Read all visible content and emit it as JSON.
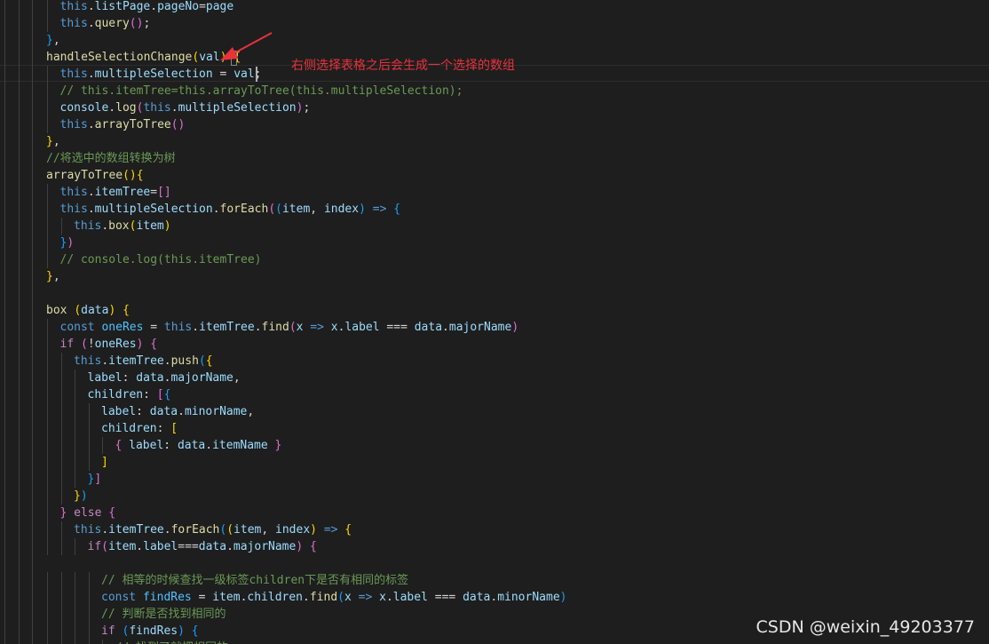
{
  "annotation": {
    "text": "右侧选择表格之后会生成一个选择的数组",
    "color": "#e8323c"
  },
  "watermark": "CSDN @weixin_49203377",
  "theme": {
    "background": "#1e1e1e",
    "keyword": "#569cd6",
    "control": "#c586c0",
    "function": "#dcdcaa",
    "variable": "#9cdcfe",
    "comment": "#6a9955"
  },
  "lines": [
    {
      "indent": 1,
      "tokens": [
        [
          "kw",
          "this"
        ],
        [
          "p",
          "."
        ],
        [
          "var",
          "listPage"
        ],
        [
          "p",
          "."
        ],
        [
          "var",
          "pageNo"
        ],
        [
          "p",
          "="
        ],
        [
          "var",
          "page"
        ]
      ]
    },
    {
      "indent": 1,
      "tokens": [
        [
          "kw",
          "this"
        ],
        [
          "p",
          "."
        ],
        [
          "fn",
          "query"
        ],
        [
          "br2",
          "()"
        ],
        [
          "p",
          ";"
        ]
      ]
    },
    {
      "indent": 0,
      "tokens": [
        [
          "br3",
          "}"
        ],
        [
          "p",
          ","
        ]
      ]
    },
    {
      "indent": 0,
      "tokens": [
        [
          "fn",
          "handleSelectionChange"
        ],
        [
          "br1",
          "("
        ],
        [
          "var",
          "val"
        ],
        [
          "br1",
          ")"
        ],
        [
          "p",
          " "
        ],
        [
          "br1",
          "{"
        ]
      ]
    },
    {
      "indent": 1,
      "tokens": [
        [
          "kw",
          "this"
        ],
        [
          "p",
          "."
        ],
        [
          "var",
          "multipleSelection"
        ],
        [
          "p",
          " = "
        ],
        [
          "var",
          "val"
        ],
        [
          "p",
          ";"
        ]
      ]
    },
    {
      "indent": 1,
      "tokens": [
        [
          "cm",
          "// this.itemTree=this.arrayToTree(this.multipleSelection);"
        ]
      ]
    },
    {
      "indent": 1,
      "tokens": [
        [
          "var",
          "console"
        ],
        [
          "p",
          "."
        ],
        [
          "fn",
          "log"
        ],
        [
          "br2",
          "("
        ],
        [
          "kw",
          "this"
        ],
        [
          "p",
          "."
        ],
        [
          "var",
          "multipleSelection"
        ],
        [
          "br2",
          ")"
        ],
        [
          "p",
          ";"
        ]
      ]
    },
    {
      "indent": 1,
      "tokens": [
        [
          "kw",
          "this"
        ],
        [
          "p",
          "."
        ],
        [
          "fn",
          "arrayToTree"
        ],
        [
          "br2",
          "()"
        ]
      ]
    },
    {
      "indent": 0,
      "tokens": [
        [
          "br1",
          "}"
        ],
        [
          "p",
          ","
        ]
      ]
    },
    {
      "indent": 0,
      "tokens": [
        [
          "cm",
          "//将选中的数组转换为树"
        ]
      ]
    },
    {
      "indent": 0,
      "tokens": [
        [
          "fn",
          "arrayToTree"
        ],
        [
          "br1",
          "()"
        ],
        [
          "br1",
          "{"
        ]
      ]
    },
    {
      "indent": 1,
      "tokens": [
        [
          "kw",
          "this"
        ],
        [
          "p",
          "."
        ],
        [
          "var",
          "itemTree"
        ],
        [
          "p",
          "="
        ],
        [
          "br2",
          "[]"
        ]
      ]
    },
    {
      "indent": 1,
      "tokens": [
        [
          "kw",
          "this"
        ],
        [
          "p",
          "."
        ],
        [
          "var",
          "multipleSelection"
        ],
        [
          "p",
          "."
        ],
        [
          "fn",
          "forEach"
        ],
        [
          "br2",
          "("
        ],
        [
          "br3",
          "("
        ],
        [
          "var",
          "item"
        ],
        [
          "p",
          ", "
        ],
        [
          "var",
          "index"
        ],
        [
          "br3",
          ")"
        ],
        [
          "p",
          " "
        ],
        [
          "kw",
          "=>"
        ],
        [
          "p",
          " "
        ],
        [
          "br3",
          "{"
        ]
      ]
    },
    {
      "indent": 2,
      "tokens": [
        [
          "kw",
          "this"
        ],
        [
          "p",
          "."
        ],
        [
          "fn",
          "box"
        ],
        [
          "br1",
          "("
        ],
        [
          "var",
          "item"
        ],
        [
          "br1",
          ")"
        ]
      ]
    },
    {
      "indent": 1,
      "tokens": [
        [
          "br3",
          "}"
        ],
        [
          "br2",
          ")"
        ]
      ]
    },
    {
      "indent": 1,
      "tokens": [
        [
          "cm",
          "// console.log(this.itemTree)"
        ]
      ]
    },
    {
      "indent": 0,
      "tokens": [
        [
          "br1",
          "}"
        ],
        [
          "p",
          ","
        ]
      ]
    },
    {
      "indent": 0,
      "tokens": []
    },
    {
      "indent": 0,
      "tokens": [
        [
          "fn",
          "box"
        ],
        [
          "p",
          " "
        ],
        [
          "br1",
          "("
        ],
        [
          "var",
          "data"
        ],
        [
          "br1",
          ")"
        ],
        [
          "p",
          " "
        ],
        [
          "br1",
          "{"
        ]
      ]
    },
    {
      "indent": 1,
      "tokens": [
        [
          "kw",
          "const"
        ],
        [
          "p",
          " "
        ],
        [
          "cst",
          "oneRes"
        ],
        [
          "p",
          " = "
        ],
        [
          "kw",
          "this"
        ],
        [
          "p",
          "."
        ],
        [
          "var",
          "itemTree"
        ],
        [
          "p",
          "."
        ],
        [
          "fn",
          "find"
        ],
        [
          "br2",
          "("
        ],
        [
          "var",
          "x"
        ],
        [
          "p",
          " "
        ],
        [
          "kw",
          "=>"
        ],
        [
          "p",
          " "
        ],
        [
          "var",
          "x"
        ],
        [
          "p",
          "."
        ],
        [
          "var",
          "label"
        ],
        [
          "p",
          " === "
        ],
        [
          "var",
          "data"
        ],
        [
          "p",
          "."
        ],
        [
          "var",
          "majorName"
        ],
        [
          "br2",
          ")"
        ]
      ]
    },
    {
      "indent": 1,
      "tokens": [
        [
          "ctrl",
          "if"
        ],
        [
          "p",
          " "
        ],
        [
          "br2",
          "("
        ],
        [
          "p",
          "!"
        ],
        [
          "var",
          "oneRes"
        ],
        [
          "br2",
          ")"
        ],
        [
          "p",
          " "
        ],
        [
          "br2",
          "{"
        ]
      ]
    },
    {
      "indent": 2,
      "tokens": [
        [
          "kw",
          "this"
        ],
        [
          "p",
          "."
        ],
        [
          "var",
          "itemTree"
        ],
        [
          "p",
          "."
        ],
        [
          "fn",
          "push"
        ],
        [
          "br3",
          "("
        ],
        [
          "br1",
          "{"
        ]
      ]
    },
    {
      "indent": 3,
      "tokens": [
        [
          "var",
          "label"
        ],
        [
          "p",
          ": "
        ],
        [
          "var",
          "data"
        ],
        [
          "p",
          "."
        ],
        [
          "var",
          "majorName"
        ],
        [
          "p",
          ","
        ]
      ]
    },
    {
      "indent": 3,
      "tokens": [
        [
          "var",
          "children"
        ],
        [
          "p",
          ": "
        ],
        [
          "br2",
          "["
        ],
        [
          "br3",
          "{"
        ]
      ]
    },
    {
      "indent": 4,
      "tokens": [
        [
          "var",
          "label"
        ],
        [
          "p",
          ": "
        ],
        [
          "var",
          "data"
        ],
        [
          "p",
          "."
        ],
        [
          "var",
          "minorName"
        ],
        [
          "p",
          ","
        ]
      ]
    },
    {
      "indent": 4,
      "tokens": [
        [
          "var",
          "children"
        ],
        [
          "p",
          ": "
        ],
        [
          "br1",
          "["
        ]
      ]
    },
    {
      "indent": 5,
      "tokens": [
        [
          "br2",
          "{"
        ],
        [
          "p",
          " "
        ],
        [
          "var",
          "label"
        ],
        [
          "p",
          ": "
        ],
        [
          "var",
          "data"
        ],
        [
          "p",
          "."
        ],
        [
          "var",
          "itemName"
        ],
        [
          "p",
          " "
        ],
        [
          "br2",
          "}"
        ]
      ]
    },
    {
      "indent": 4,
      "tokens": [
        [
          "br1",
          "]"
        ]
      ]
    },
    {
      "indent": 3,
      "tokens": [
        [
          "br3",
          "}"
        ],
        [
          "br2",
          "]"
        ]
      ]
    },
    {
      "indent": 2,
      "tokens": [
        [
          "br1",
          "}"
        ],
        [
          "br3",
          ")"
        ]
      ]
    },
    {
      "indent": 1,
      "tokens": [
        [
          "br2",
          "}"
        ],
        [
          "p",
          " "
        ],
        [
          "ctrl",
          "else"
        ],
        [
          "p",
          " "
        ],
        [
          "br2",
          "{"
        ]
      ]
    },
    {
      "indent": 2,
      "tokens": [
        [
          "kw",
          "this"
        ],
        [
          "p",
          "."
        ],
        [
          "var",
          "itemTree"
        ],
        [
          "p",
          "."
        ],
        [
          "fn",
          "forEach"
        ],
        [
          "br3",
          "("
        ],
        [
          "br1",
          "("
        ],
        [
          "var",
          "item"
        ],
        [
          "p",
          ", "
        ],
        [
          "var",
          "index"
        ],
        [
          "br1",
          ")"
        ],
        [
          "p",
          " "
        ],
        [
          "kw",
          "=>"
        ],
        [
          "p",
          " "
        ],
        [
          "br1",
          "{"
        ]
      ]
    },
    {
      "indent": 3,
      "tokens": [
        [
          "ctrl",
          "if"
        ],
        [
          "br2",
          "("
        ],
        [
          "var",
          "item"
        ],
        [
          "p",
          "."
        ],
        [
          "var",
          "label"
        ],
        [
          "p",
          "==="
        ],
        [
          "var",
          "data"
        ],
        [
          "p",
          "."
        ],
        [
          "var",
          "majorName"
        ],
        [
          "br2",
          ")"
        ],
        [
          "p",
          " "
        ],
        [
          "br2",
          "{"
        ]
      ]
    },
    {
      "indent": 0,
      "tokens": []
    },
    {
      "indent": 4,
      "tokens": [
        [
          "cm",
          "// 相等的时候查找一级标签children下是否有相同的标签"
        ]
      ]
    },
    {
      "indent": 4,
      "tokens": [
        [
          "kw",
          "const"
        ],
        [
          "p",
          " "
        ],
        [
          "cst",
          "findRes"
        ],
        [
          "p",
          " = "
        ],
        [
          "var",
          "item"
        ],
        [
          "p",
          "."
        ],
        [
          "var",
          "children"
        ],
        [
          "p",
          "."
        ],
        [
          "fn",
          "find"
        ],
        [
          "br3",
          "("
        ],
        [
          "var",
          "x"
        ],
        [
          "p",
          " "
        ],
        [
          "kw",
          "=>"
        ],
        [
          "p",
          " "
        ],
        [
          "var",
          "x"
        ],
        [
          "p",
          "."
        ],
        [
          "var",
          "label"
        ],
        [
          "p",
          " === "
        ],
        [
          "var",
          "data"
        ],
        [
          "p",
          "."
        ],
        [
          "var",
          "minorName"
        ],
        [
          "br3",
          ")"
        ]
      ]
    },
    {
      "indent": 4,
      "tokens": [
        [
          "cm",
          "// 判断是否找到相同的"
        ]
      ]
    },
    {
      "indent": 4,
      "tokens": [
        [
          "ctrl",
          "if"
        ],
        [
          "p",
          " "
        ],
        [
          "br3",
          "("
        ],
        [
          "var",
          "findRes"
        ],
        [
          "br3",
          ")"
        ],
        [
          "p",
          " "
        ],
        [
          "br3",
          "{"
        ]
      ]
    },
    {
      "indent": 5,
      "tokens": [
        [
          "cm",
          "// 找到了就把相同的"
        ]
      ]
    }
  ]
}
